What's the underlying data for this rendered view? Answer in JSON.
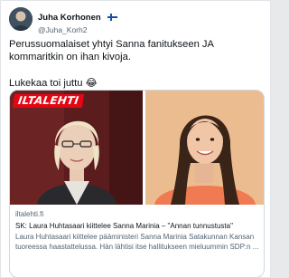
{
  "author": {
    "display_name": "Juha Korhonen",
    "handle": "@Juha_Korh2",
    "flag_icon": "finland-flag-icon"
  },
  "tweet": {
    "line1": "Perussuomalaiset yhtyi Sanna fanitukseen JA kommaritkin on ihan kivoja.",
    "line2": "Lukekaa toi juttu 😂"
  },
  "card": {
    "logo_text": "ILTALEHTI",
    "domain": "iltalehti.fi",
    "title": "SK: Laura Huhtasaari kiittelee Sanna Marinia – \"Annan tunnustusta\"",
    "description": "Laura Huhtasaari kiittelee pääministeri Sanna Marinia Satakunnan Kansan tuoreessa haastattelussa. Hän lähtisi itse hallitukseen mieluummin SDP:n ..."
  },
  "colors": {
    "logo_red": "#e30613",
    "text": "#0f1419",
    "muted": "#536471",
    "border": "#cfd9de"
  }
}
